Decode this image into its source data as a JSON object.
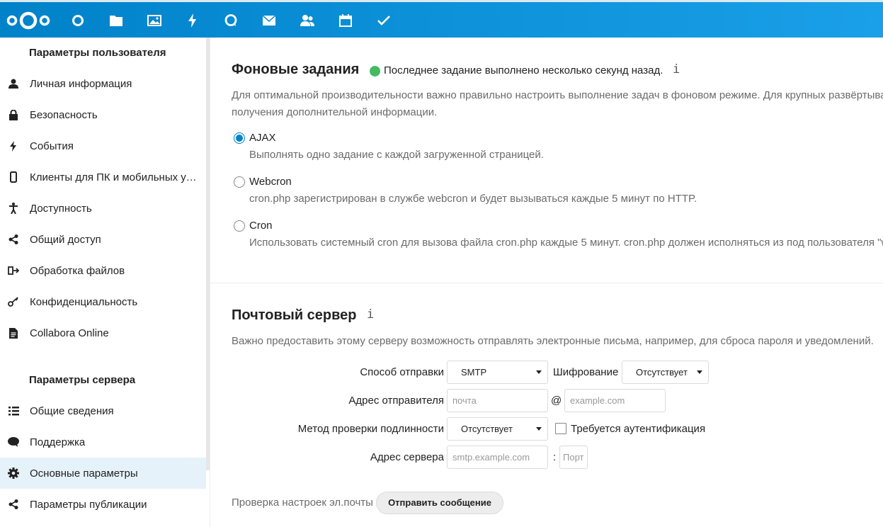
{
  "topbar": {
    "accent": "#0082c9",
    "apps": [
      "dashboard-icon",
      "files-icon",
      "photos-icon",
      "activity-icon",
      "talk-icon",
      "mail-icon",
      "contacts-icon",
      "calendar-icon",
      "tasks-icon"
    ]
  },
  "sidebar": {
    "user_heading": "Параметры пользователя",
    "user_items": [
      {
        "label": "Личная информация",
        "icon": "person-icon"
      },
      {
        "label": "Безопасность",
        "icon": "lock-icon"
      },
      {
        "label": "События",
        "icon": "lightning-icon"
      },
      {
        "label": "Клиенты для ПК и мобильных устройств",
        "icon": "phone-icon"
      },
      {
        "label": "Доступность",
        "icon": "accessibility-icon"
      },
      {
        "label": "Общий доступ",
        "icon": "share-icon"
      },
      {
        "label": "Обработка файлов",
        "icon": "file-flow-icon"
      },
      {
        "label": "Конфиденциальность",
        "icon": "key-icon"
      },
      {
        "label": "Collabora Online",
        "icon": "document-icon"
      }
    ],
    "server_heading": "Параметры сервера",
    "server_items": [
      {
        "label": "Общие сведения",
        "icon": "list-icon"
      },
      {
        "label": "Поддержка",
        "icon": "chat-bubble-icon"
      },
      {
        "label": "Основные параметры",
        "icon": "gear-icon",
        "active": true
      },
      {
        "label": "Параметры публикации",
        "icon": "share-icon"
      }
    ]
  },
  "background_jobs": {
    "title": "Фоновые задания",
    "status": "Последнее задание выполнено несколько секунд назад.",
    "info": "i",
    "description_line1": "Для оптимальной производительности важно правильно настроить выполнение задач в фоновом режиме. Для крупных развёртываний рекомендуется",
    "description_line2": "получения дополнительной информации.",
    "options": [
      {
        "title": "AJAX",
        "desc": "Выполнять одно задание с каждой загруженной страницей.",
        "checked": true
      },
      {
        "title": "Webcron",
        "desc": "cron.php зарегистрирован в службе webcron и будет вызываться каждые 5 минут по HTTP.",
        "checked": false
      },
      {
        "title": "Cron",
        "desc": "Использовать системный cron для вызова файла cron.php каждые 5 минут. cron.php должен исполняться из под пользователя \"www-data\".",
        "checked": false
      }
    ]
  },
  "mail_server": {
    "title": "Почтовый сервер",
    "info": "i",
    "description": "Важно предоставить этому серверу возможность отправлять электронные письма, например, для сброса пароля и уведомлений.",
    "send_mode_label": "Способ отправки",
    "send_mode_value": "SMTP",
    "encryption_label": "Шифрование",
    "encryption_value": "Отсутствует",
    "from_label": "Адрес отправителя",
    "from_placeholder": "почта",
    "at": "@",
    "domain_placeholder": "example.com",
    "auth_method_label": "Метод проверки подлинности",
    "auth_method_value": "Отсутствует",
    "auth_required_label": "Требуется аутентификация",
    "server_label": "Адрес сервера",
    "server_placeholder": "smtp.example.com",
    "colon": ":",
    "port_placeholder": "Порт",
    "test_label": "Проверка настроек эл.почты",
    "send_button": "Отправить сообщение"
  }
}
